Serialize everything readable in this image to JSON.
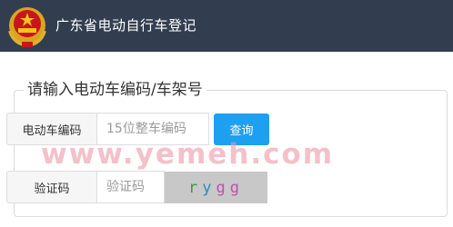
{
  "header": {
    "title": "广东省电动自行车登记"
  },
  "form": {
    "legend": "请输入电动车编码/车架号",
    "vehicle_code_label": "电动车编码",
    "vehicle_code_placeholder": "15位整车编码",
    "query_button": "查询",
    "captcha_label": "验证码",
    "captcha_placeholder": "验证码",
    "captcha_chars": [
      "r",
      "y",
      "g",
      "g"
    ]
  },
  "watermark": "www.yemeh.com",
  "colors": {
    "header_bg": "#323e50",
    "button_bg": "#1ea0f0",
    "captcha_bg": "#c8c8c8"
  }
}
